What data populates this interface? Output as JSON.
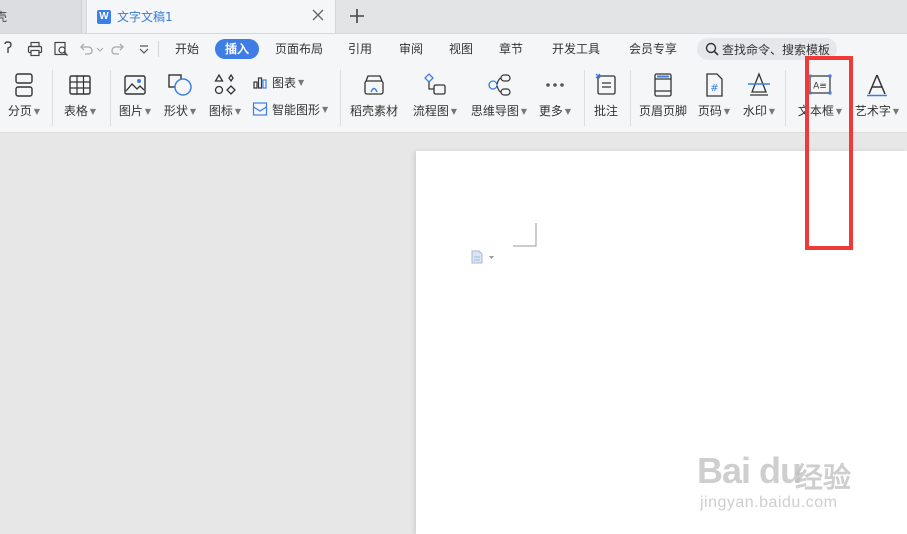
{
  "tabs": {
    "prev_tab_label": "壳",
    "active_tab_label": "文字文稿1",
    "doc_icon_letter": "W"
  },
  "menu": {
    "items": [
      "开始",
      "插入",
      "页面布局",
      "引用",
      "审阅",
      "视图",
      "章节",
      "开发工具",
      "会员专享"
    ],
    "active_index": 1,
    "search_placeholder": "查找命令、搜索模板"
  },
  "ribbon": {
    "page_break": "分页",
    "table": "表格",
    "picture": "图片",
    "shape": "形状",
    "icon": "图标",
    "chart": "图表",
    "smart_graphic": "智能图形",
    "docer_material": "稻壳素材",
    "flowchart": "流程图",
    "mindmap": "思维导图",
    "more": "更多",
    "comment": "批注",
    "header_footer": "页眉页脚",
    "page_number": "页码",
    "watermark": "水印",
    "text_box": "文本框",
    "word_art": "艺术字",
    "text_box_icon_text": "A≡"
  },
  "watermark_overlay": {
    "brand": "Bai du",
    "brand_cn": "经验",
    "url": "jingyan.baidu.com"
  },
  "colors": {
    "accent": "#3e7de6",
    "highlight": "#f03a3a"
  }
}
